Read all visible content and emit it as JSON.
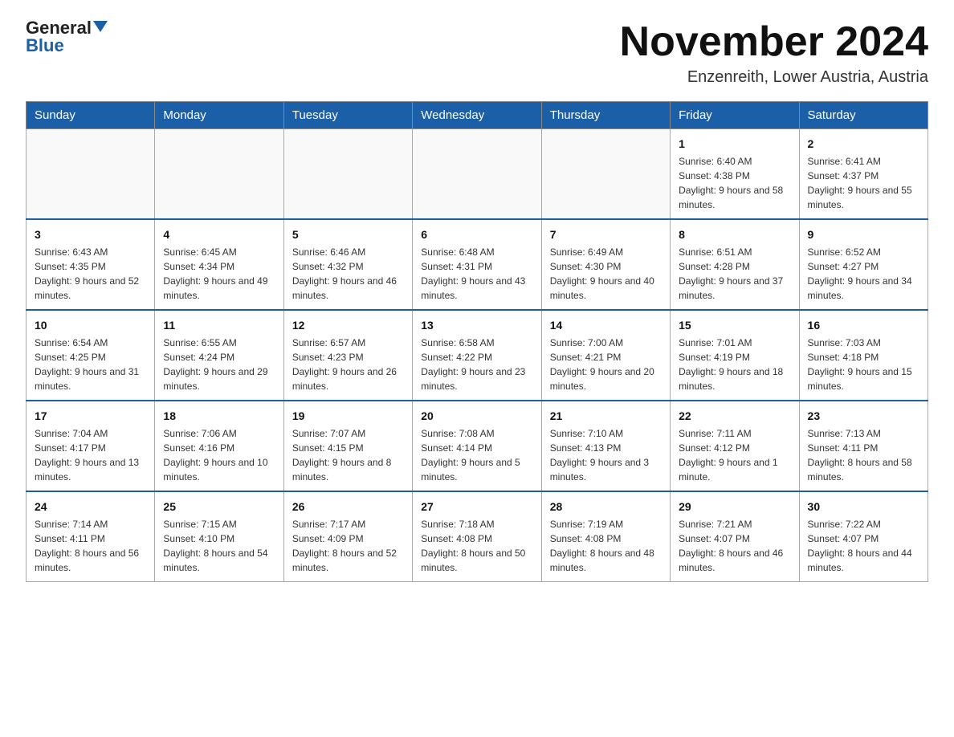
{
  "logo": {
    "part1": "General",
    "part2": "Blue"
  },
  "title": "November 2024",
  "subtitle": "Enzenreith, Lower Austria, Austria",
  "days_of_week": [
    "Sunday",
    "Monday",
    "Tuesday",
    "Wednesday",
    "Thursday",
    "Friday",
    "Saturday"
  ],
  "weeks": [
    [
      {
        "day": "",
        "info": ""
      },
      {
        "day": "",
        "info": ""
      },
      {
        "day": "",
        "info": ""
      },
      {
        "day": "",
        "info": ""
      },
      {
        "day": "",
        "info": ""
      },
      {
        "day": "1",
        "info": "Sunrise: 6:40 AM\nSunset: 4:38 PM\nDaylight: 9 hours and 58 minutes."
      },
      {
        "day": "2",
        "info": "Sunrise: 6:41 AM\nSunset: 4:37 PM\nDaylight: 9 hours and 55 minutes."
      }
    ],
    [
      {
        "day": "3",
        "info": "Sunrise: 6:43 AM\nSunset: 4:35 PM\nDaylight: 9 hours and 52 minutes."
      },
      {
        "day": "4",
        "info": "Sunrise: 6:45 AM\nSunset: 4:34 PM\nDaylight: 9 hours and 49 minutes."
      },
      {
        "day": "5",
        "info": "Sunrise: 6:46 AM\nSunset: 4:32 PM\nDaylight: 9 hours and 46 minutes."
      },
      {
        "day": "6",
        "info": "Sunrise: 6:48 AM\nSunset: 4:31 PM\nDaylight: 9 hours and 43 minutes."
      },
      {
        "day": "7",
        "info": "Sunrise: 6:49 AM\nSunset: 4:30 PM\nDaylight: 9 hours and 40 minutes."
      },
      {
        "day": "8",
        "info": "Sunrise: 6:51 AM\nSunset: 4:28 PM\nDaylight: 9 hours and 37 minutes."
      },
      {
        "day": "9",
        "info": "Sunrise: 6:52 AM\nSunset: 4:27 PM\nDaylight: 9 hours and 34 minutes."
      }
    ],
    [
      {
        "day": "10",
        "info": "Sunrise: 6:54 AM\nSunset: 4:25 PM\nDaylight: 9 hours and 31 minutes."
      },
      {
        "day": "11",
        "info": "Sunrise: 6:55 AM\nSunset: 4:24 PM\nDaylight: 9 hours and 29 minutes."
      },
      {
        "day": "12",
        "info": "Sunrise: 6:57 AM\nSunset: 4:23 PM\nDaylight: 9 hours and 26 minutes."
      },
      {
        "day": "13",
        "info": "Sunrise: 6:58 AM\nSunset: 4:22 PM\nDaylight: 9 hours and 23 minutes."
      },
      {
        "day": "14",
        "info": "Sunrise: 7:00 AM\nSunset: 4:21 PM\nDaylight: 9 hours and 20 minutes."
      },
      {
        "day": "15",
        "info": "Sunrise: 7:01 AM\nSunset: 4:19 PM\nDaylight: 9 hours and 18 minutes."
      },
      {
        "day": "16",
        "info": "Sunrise: 7:03 AM\nSunset: 4:18 PM\nDaylight: 9 hours and 15 minutes."
      }
    ],
    [
      {
        "day": "17",
        "info": "Sunrise: 7:04 AM\nSunset: 4:17 PM\nDaylight: 9 hours and 13 minutes."
      },
      {
        "day": "18",
        "info": "Sunrise: 7:06 AM\nSunset: 4:16 PM\nDaylight: 9 hours and 10 minutes."
      },
      {
        "day": "19",
        "info": "Sunrise: 7:07 AM\nSunset: 4:15 PM\nDaylight: 9 hours and 8 minutes."
      },
      {
        "day": "20",
        "info": "Sunrise: 7:08 AM\nSunset: 4:14 PM\nDaylight: 9 hours and 5 minutes."
      },
      {
        "day": "21",
        "info": "Sunrise: 7:10 AM\nSunset: 4:13 PM\nDaylight: 9 hours and 3 minutes."
      },
      {
        "day": "22",
        "info": "Sunrise: 7:11 AM\nSunset: 4:12 PM\nDaylight: 9 hours and 1 minute."
      },
      {
        "day": "23",
        "info": "Sunrise: 7:13 AM\nSunset: 4:11 PM\nDaylight: 8 hours and 58 minutes."
      }
    ],
    [
      {
        "day": "24",
        "info": "Sunrise: 7:14 AM\nSunset: 4:11 PM\nDaylight: 8 hours and 56 minutes."
      },
      {
        "day": "25",
        "info": "Sunrise: 7:15 AM\nSunset: 4:10 PM\nDaylight: 8 hours and 54 minutes."
      },
      {
        "day": "26",
        "info": "Sunrise: 7:17 AM\nSunset: 4:09 PM\nDaylight: 8 hours and 52 minutes."
      },
      {
        "day": "27",
        "info": "Sunrise: 7:18 AM\nSunset: 4:08 PM\nDaylight: 8 hours and 50 minutes."
      },
      {
        "day": "28",
        "info": "Sunrise: 7:19 AM\nSunset: 4:08 PM\nDaylight: 8 hours and 48 minutes."
      },
      {
        "day": "29",
        "info": "Sunrise: 7:21 AM\nSunset: 4:07 PM\nDaylight: 8 hours and 46 minutes."
      },
      {
        "day": "30",
        "info": "Sunrise: 7:22 AM\nSunset: 4:07 PM\nDaylight: 8 hours and 44 minutes."
      }
    ]
  ]
}
